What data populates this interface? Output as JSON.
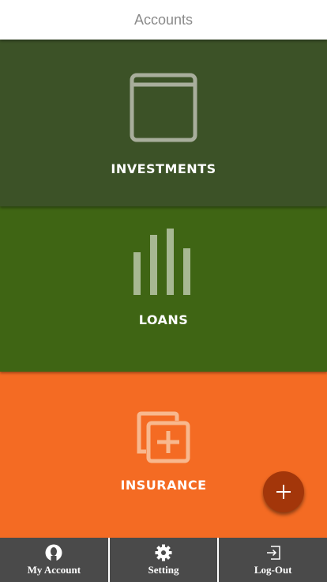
{
  "header": {
    "title": "Accounts"
  },
  "tiles": {
    "investments": {
      "label": "INVESTMENTS",
      "icon": "window-icon",
      "color": "#3c5227"
    },
    "loans": {
      "label": "LOANS",
      "icon": "bar-chart-icon",
      "color": "#3f6514"
    },
    "insurance": {
      "label": "INSURANCE",
      "icon": "add-copy-icon",
      "color": "#f46b23"
    }
  },
  "fab": {
    "icon": "plus-icon",
    "color": "#a3360a"
  },
  "bottom_nav": {
    "items": [
      {
        "label": "My Account",
        "icon": "user-icon"
      },
      {
        "label": "Setting",
        "icon": "gear-icon"
      },
      {
        "label": "Log-Out",
        "icon": "logout-icon"
      }
    ],
    "color": "#4a4a4a"
  }
}
